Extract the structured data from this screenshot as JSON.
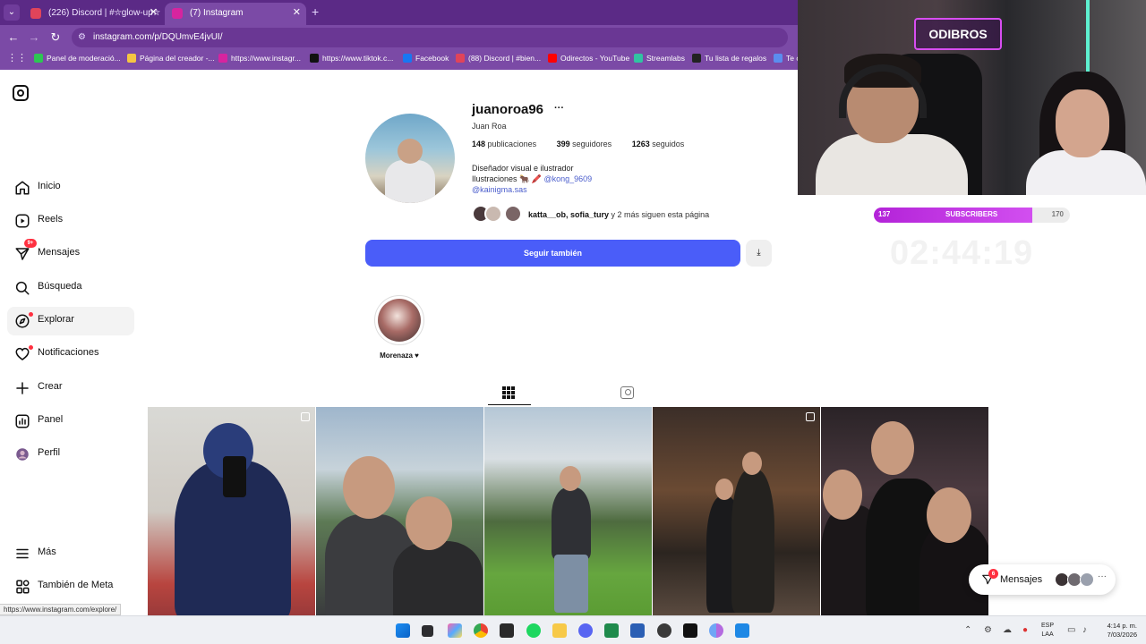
{
  "browser": {
    "tabs": [
      {
        "label": "(226) Discord | #⛥glow-up⛥",
        "favicon_color": "#e0445a"
      },
      {
        "label": "(7) Instagram",
        "favicon_color": "#d6249f"
      }
    ],
    "new_tab_symbol": "+",
    "close_symbol": "✕",
    "url": "instagram.com/p/DQUmvE4jvUI/",
    "bookmarks": [
      {
        "label": "Panel de moderació...",
        "color": "#2dc653"
      },
      {
        "label": "Página del creador -...",
        "color": "#f5c542"
      },
      {
        "label": "https://www.instagr...",
        "color": "#d6249f"
      },
      {
        "label": "https://www.tiktok.c...",
        "color": "#111111"
      },
      {
        "label": "Facebook",
        "color": "#1877f2"
      },
      {
        "label": "(88) Discord | #bien...",
        "color": "#e0445a"
      },
      {
        "label": "Odirectos - YouTube",
        "color": "#ff0000"
      },
      {
        "label": "Streamlabs",
        "color": "#31c3a2"
      },
      {
        "label": "Tu lista de regalos",
        "color": "#222222"
      },
      {
        "label": "Te c",
        "color": "#5b8def"
      }
    ]
  },
  "sidebar": {
    "items": [
      {
        "label": "Inicio",
        "icon": "home-icon"
      },
      {
        "label": "Reels",
        "icon": "reels-icon"
      },
      {
        "label": "Mensajes",
        "icon": "messages-icon",
        "badge": "9+"
      },
      {
        "label": "Búsqueda",
        "icon": "search-icon"
      },
      {
        "label": "Explorar",
        "icon": "explore-icon"
      },
      {
        "label": "Notificaciones",
        "icon": "heart-icon"
      },
      {
        "label": "Crear",
        "icon": "plus-icon"
      },
      {
        "label": "Panel",
        "icon": "dashboard-icon"
      },
      {
        "label": "Perfil",
        "icon": "avatar-icon"
      },
      {
        "label": "Más",
        "icon": "menu-icon"
      },
      {
        "label": "También de Meta",
        "icon": "meta-icon"
      }
    ]
  },
  "profile": {
    "username": "juanoroa96",
    "more": "···",
    "full_name": "Juan Roa",
    "posts_count": "148",
    "posts_label": "publicaciones",
    "followers_count": "399",
    "followers_label": "seguidores",
    "following_count": "1263",
    "following_label": "seguidos",
    "bio_line1": "Diseñador visual e ilustrador",
    "bio_line2_prefix": "Ilustraciones 🐂 🖍️",
    "bio_mention": "@kong_9609",
    "bio_link": "@kainigma.sas",
    "followed_by_names": "katta__ob, sofia_tury",
    "followed_by_suffix": "y 2 más siguen esta página",
    "follow_button": "Seguir también",
    "suggest_icon": "⤓",
    "highlight_label": "Morenaza ♥"
  },
  "status_url": "https://www.instagram.com/explore/",
  "messages_pill": {
    "label": "Mensajes",
    "badge": "6",
    "more": "···"
  },
  "overlay": {
    "neon_sign": "ODIBROS",
    "subscribers_current": "137",
    "subscribers_label": "SUBSCRIBERS",
    "subscribers_goal": "170",
    "subscribers_progress": 0.806,
    "timer": "02:44:19"
  },
  "taskbar": {
    "lang_line1": "ESP",
    "lang_line2": "LAA",
    "time": "4:14 p. m.",
    "date": "7/03/2026"
  }
}
